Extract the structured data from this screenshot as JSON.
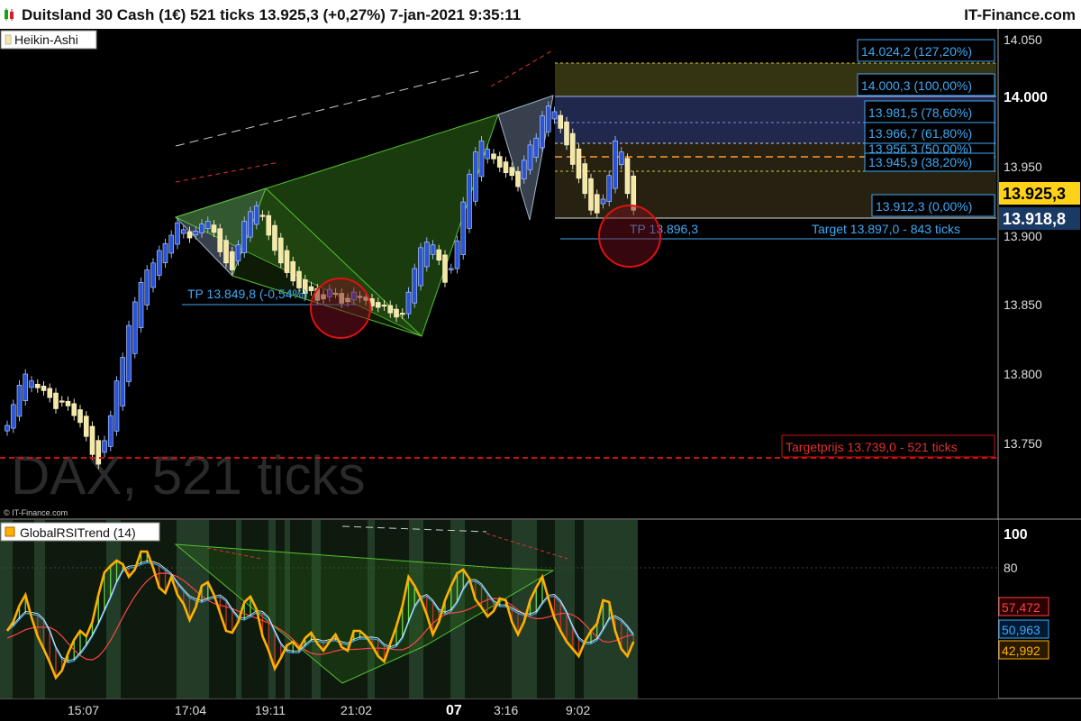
{
  "header": {
    "title": "Duitsland 30 Cash (1€) 521 ticks 13.925,3 (+0,27%) 7-jan-2021 9:35:11",
    "brand": "IT-Finance.com"
  },
  "main_panel": {
    "indicator_label": "Heikin-Ashi",
    "watermark": "DAX, 521 ticks",
    "copyright": "© IT-Finance.com",
    "price_axis_ticks": [
      "14.050",
      "14.000",
      "13.950",
      "13.900",
      "13.850",
      "13.800",
      "13.750"
    ],
    "current_price_label": "13.925,3",
    "second_price_label": "13.918,8",
    "fib_labels": [
      "14.024,2 (127,20%)",
      "14.000,3 (100,00%)",
      "13.981,5 (78,60%)",
      "13.966,7 (61,80%)",
      "13.956,3 (50,00%)",
      "13.945,9 (38,20%)",
      "13.912,3 (0,00%)"
    ],
    "target_label": "Target 13.897,0 - 843 ticks",
    "tp_label_right": "TP 13.896,3",
    "tp_label_left": "TP 13.849,8 (-0,54%)",
    "targetprijs_label": "Targetprijs 13.739,0 - 521 ticks"
  },
  "rsi_panel": {
    "label": "GlobalRSITrend (14)",
    "axis_ticks": [
      "100",
      "80"
    ],
    "value_labels": [
      "57,472",
      "50,963",
      "42,992"
    ],
    "colors": {
      "upper": "#ff4444",
      "mid": "#3fa9f5",
      "lower": "#ffb000"
    }
  },
  "time_axis": [
    "15:07",
    "17:04",
    "19:11",
    "21:02",
    "07",
    "3:16",
    "9:02"
  ],
  "colors": {
    "background": "#000000",
    "bull": "#2a54d6",
    "bear": "#f4e8a4",
    "fib_box": "#0c2a55",
    "accent_cyan": "#3fa9f5",
    "target_red": "#d01010"
  },
  "chart_data": {
    "type": "candlestick",
    "title": "Duitsland 30 Cash (1€) 521 ticks",
    "ylim": [
      13730,
      14060
    ],
    "ha_close": [
      13763,
      13778,
      13792,
      13800,
      13795,
      13790,
      13788,
      13783,
      13775,
      13780,
      13777,
      13770,
      13765,
      13755,
      13742,
      13735,
      13752,
      13770,
      13795,
      13812,
      13835,
      13852,
      13866,
      13875,
      13880,
      13889,
      13894,
      13900,
      13909,
      13904,
      13898,
      13903,
      13908,
      13910,
      13902,
      13888,
      13880,
      13875,
      13893,
      13910,
      13917,
      13921,
      13914,
      13900,
      13889,
      13880,
      13873,
      13867,
      13862,
      13858,
      13860,
      13853,
      13854,
      13861,
      13858,
      13851,
      13852,
      13859,
      13855,
      13853,
      13849,
      13848,
      13849,
      13844,
      13841,
      13843,
      13859,
      13876,
      13891,
      13895,
      13893,
      13882,
      13866,
      13876,
      13896,
      13924,
      13944,
      13960,
      13968,
      13962,
      13955,
      13949,
      13945,
      13943,
      13935,
      13954,
      13965,
      13970,
      13986,
      13993,
      13989,
      13977,
      13965,
      13951,
      13941,
      13930,
      13918,
      13916,
      13926,
      13943,
      13968,
      13960,
      13930,
      13918
    ],
    "lines": {
      "fib_0": 13912.3,
      "fib_100": 14000.3,
      "fib_127": 14024.2,
      "target": 13897.0,
      "tp_right": 13896.3,
      "tp_left": 13849.8,
      "targetprijs": 13739.0
    }
  }
}
